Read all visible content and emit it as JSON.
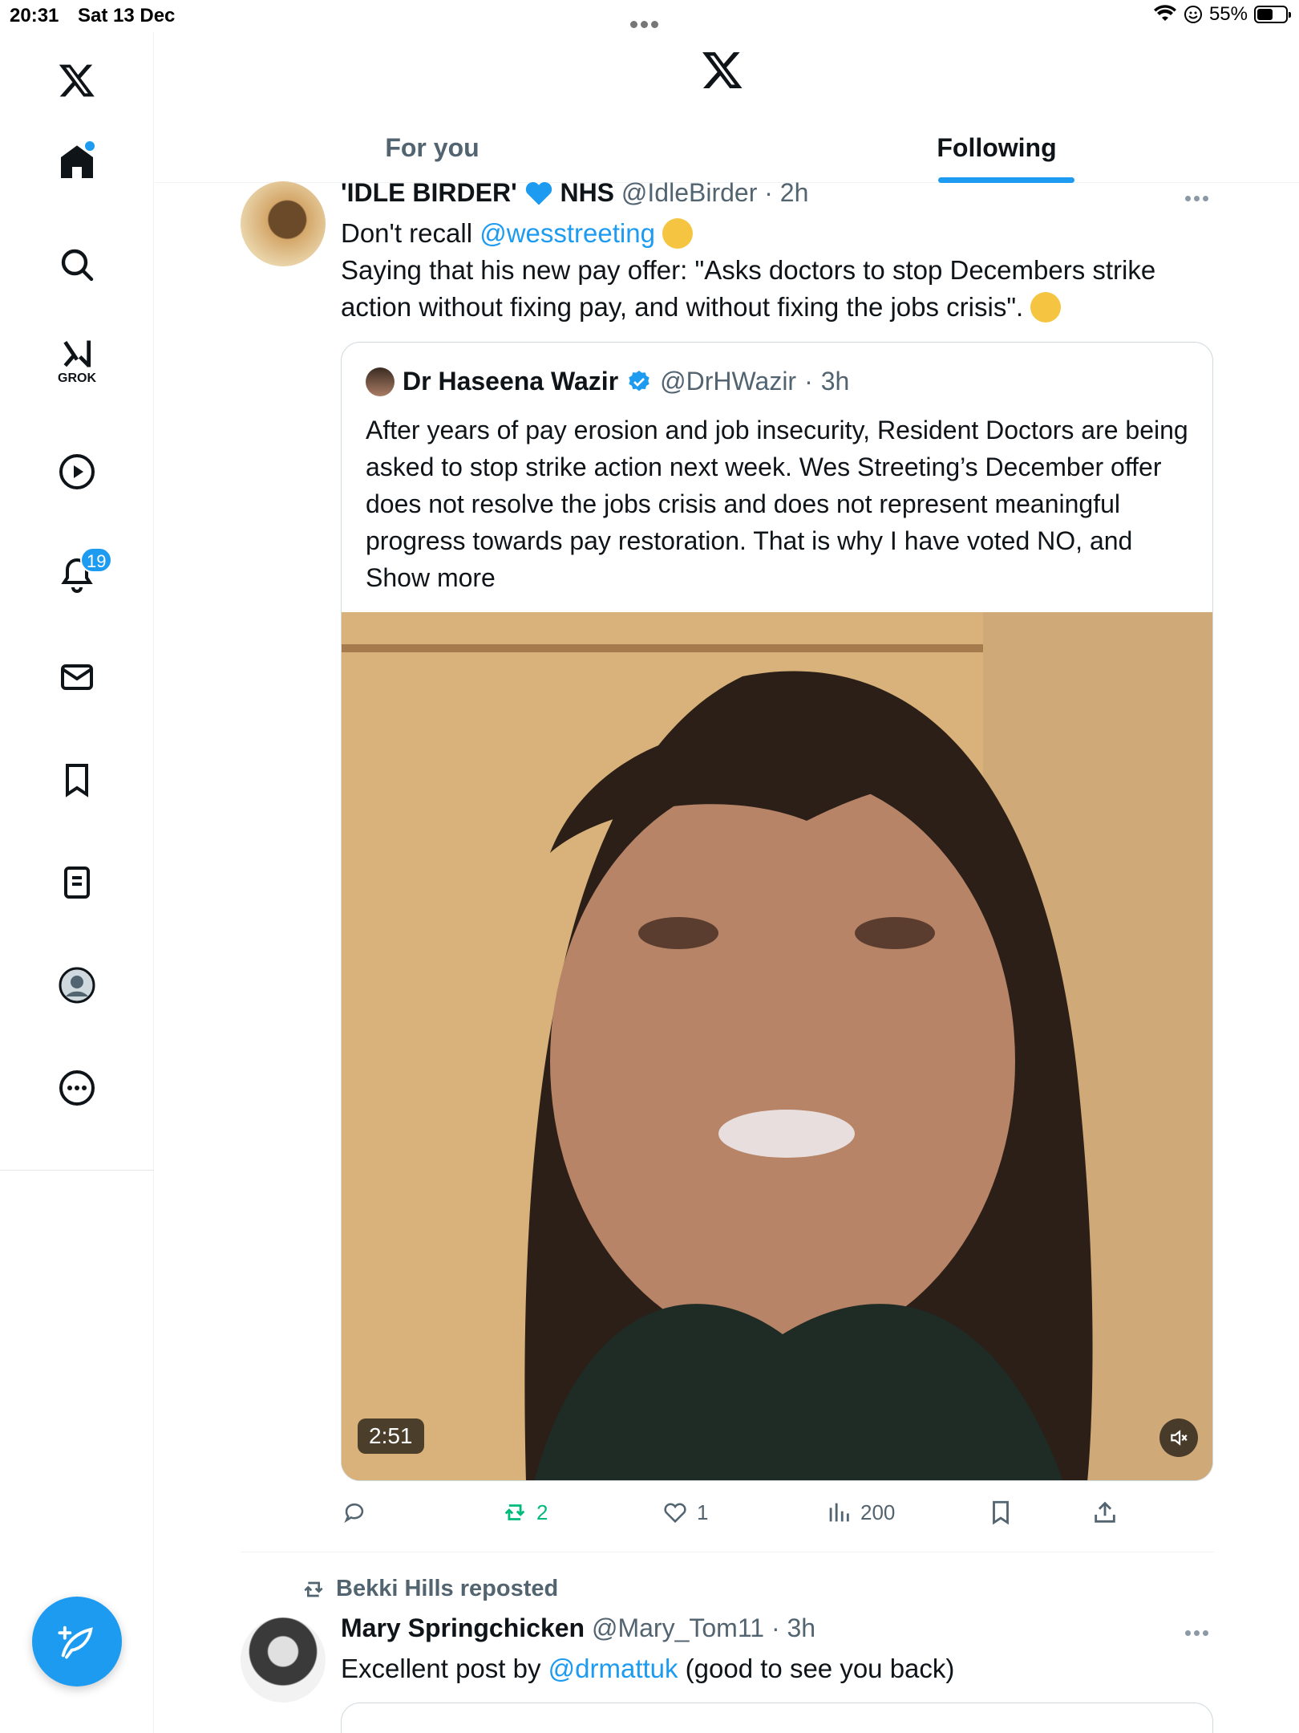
{
  "status_bar": {
    "time": "20:31",
    "date": "Sat 13 Dec",
    "battery": "55%",
    "battery_level": 0.55
  },
  "sidebar": {
    "grok_label": "GROK",
    "notification_count": "19"
  },
  "tabs": [
    {
      "label": "For you",
      "active": false
    },
    {
      "label": "Following",
      "active": true
    }
  ],
  "post1": {
    "name": "'IDLE BIRDER'",
    "name_suffix": "NHS",
    "handle": "@IdleBirder",
    "time": "2h",
    "text_line1_prefix": "Don't recall ",
    "mention": "@wesstreeting",
    "text_body": "Saying that his new pay offer: \"Asks doctors to stop Decembers strike action without fixing pay, and without fixing the jobs crisis\".",
    "quote": {
      "name": "Dr Haseena Wazir",
      "handle": "@DrHWazir",
      "time": "3h",
      "text": "After years of pay erosion and job insecurity, Resident Doctors are being asked to stop strike action next week. Wes Streeting’s December offer does not resolve the jobs crisis and does not represent meaningful progress towards pay restoration. That is why I have voted NO, and",
      "show_more": "Show more",
      "video_duration": "2:51"
    },
    "actions": {
      "replies": "",
      "reposts": "2",
      "likes": "1",
      "views": "200"
    }
  },
  "post2": {
    "repost_label": "Bekki Hills reposted",
    "name": "Mary Springchicken",
    "handle": "@Mary_Tom11",
    "time": "3h",
    "text_prefix": "Excellent post by ",
    "mention": "@drmattuk",
    "text_suffix": " (good to see you back)"
  },
  "colors": {
    "accent": "#1d9bf0",
    "muted": "#536471",
    "repost_green": "#00ba7c"
  },
  "icons": [
    "x-logo-icon",
    "home-icon",
    "search-icon",
    "grok-icon",
    "video-icon",
    "notifications-icon",
    "messages-icon",
    "bookmarks-icon",
    "lists-icon",
    "profile-icon",
    "more-icon",
    "compose-icon",
    "verified-icon",
    "heart-emoji-icon",
    "reply-icon",
    "repost-icon",
    "like-icon",
    "views-icon",
    "bookmark-icon",
    "share-icon",
    "mute-icon"
  ]
}
